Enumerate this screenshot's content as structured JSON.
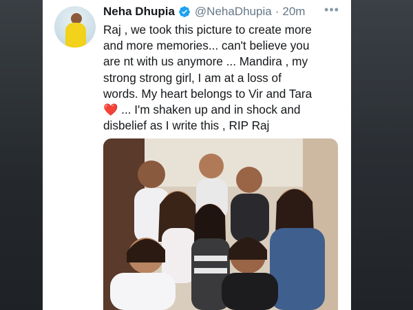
{
  "tweet": {
    "display_name": "Neha Dhupia",
    "handle": "@NehaDhupia",
    "separator": "·",
    "time": "20m",
    "more_label": "•••",
    "lines": [
      "Raj , we took this picture to create more",
      "and more memories... can't believe you",
      "are nt with us anymore ... Mandira , my",
      "strong  strong girl, I am at a loss of",
      "words. My heart belongs to Vir and Tara",
      " ... I'm shaken up and in shock and",
      "disbelief as I write this , RIP Raj"
    ],
    "heart_glyph": "❤️"
  },
  "icons": {
    "verified": "verified-badge-icon",
    "more": "more-options-icon"
  },
  "colors": {
    "verified_blue": "#1da1f2",
    "heart_red": "#e0242e",
    "text": "#14171a",
    "muted": "#657786"
  }
}
